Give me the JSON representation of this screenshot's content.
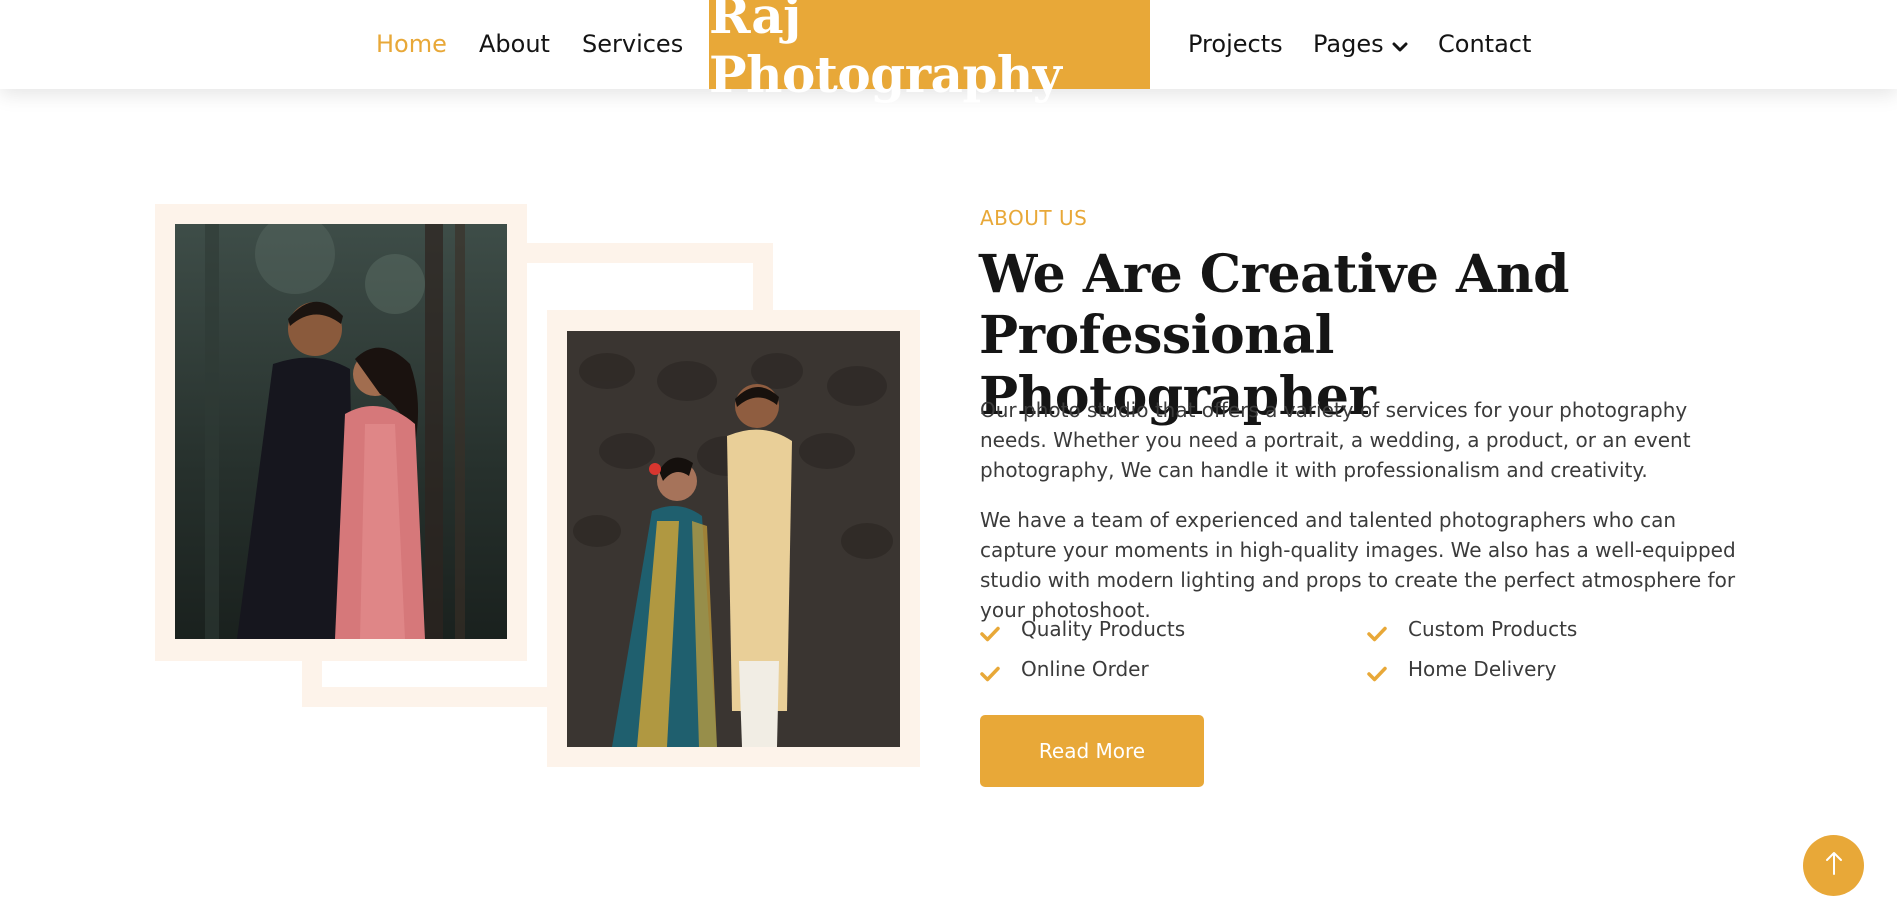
{
  "nav": {
    "home": "Home",
    "about": "About",
    "services": "Services",
    "brand": "Raj Photography",
    "projects": "Projects",
    "pages": "Pages",
    "contact": "Contact"
  },
  "about": {
    "eyebrow": "ABOUT US",
    "headline_line1": "We Are Creative And",
    "headline_line2": "Professional Photographer",
    "para1": "Our photo studio that offers a variety of services for your photography needs. Whether you need a portrait, a wedding, a product, or an event photography, We can handle it with professionalism and creativity.",
    "para2": "We have a team of experienced and talented photographers who can capture your moments in high-quality images. We also has a well-equipped studio with modern lighting and props to create the perfect atmosphere for your photoshoot.",
    "features": [
      "Quality Products",
      "Custom Products",
      "Online Order",
      "Home Delivery"
    ],
    "button": "Read More"
  },
  "colors": {
    "accent": "#e8a838",
    "frame": "#fdf3ea",
    "heading": "#151515",
    "text": "#3b3b3b"
  },
  "icons": {
    "feature": "check-icon",
    "nav_dropdown": "chevron-down-icon",
    "back_to_top": "arrow-up-icon"
  }
}
